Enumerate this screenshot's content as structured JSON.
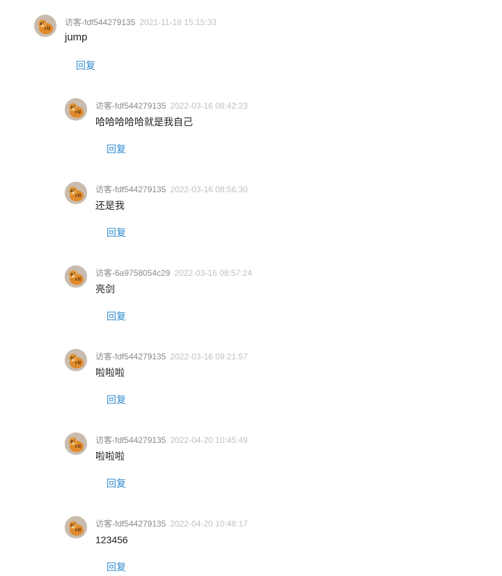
{
  "comments": [
    {
      "author": "访客-fdf544279135",
      "time": "2021-11-18 15:15:33",
      "text": "jump",
      "reply_label": "回复"
    },
    {
      "author": "访客-fdf544279135",
      "time": "2022-03-16 08:42:23",
      "text": "哈哈哈哈哈就是我自己",
      "reply_label": "回复"
    },
    {
      "author": "访客-fdf544279135",
      "time": "2022-03-16 08:56:30",
      "text": "还是我",
      "reply_label": "回复"
    },
    {
      "author": "访客-6a9758054c29",
      "time": "2022-03-16 08:57:24",
      "text": "亮剑",
      "reply_label": "回复"
    },
    {
      "author": "访客-fdf544279135",
      "time": "2022-03-16 09:21:57",
      "text": "啦啦啦",
      "reply_label": "回复"
    },
    {
      "author": "访客-fdf544279135",
      "time": "2022-04-20 10:45:49",
      "text": "啦啦啦",
      "reply_label": "回复"
    },
    {
      "author": "访客-fdf544279135",
      "time": "2022-04-20 10:46:17",
      "text": "123456",
      "reply_label": "回复"
    }
  ],
  "avatar_icon": "tiger-avatar-icon",
  "colors": {
    "reply_link": "#2f8bd0",
    "author": "#8a8a8a",
    "timestamp": "#c0c0c0",
    "text": "#222222"
  }
}
